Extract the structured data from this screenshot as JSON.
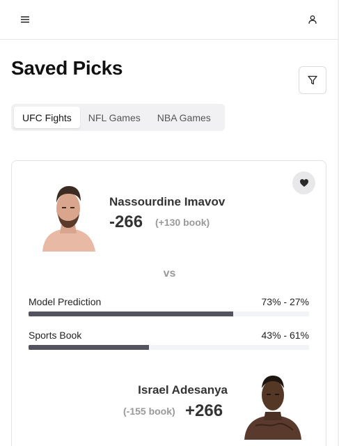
{
  "page": {
    "title": "Saved Picks"
  },
  "tabs": [
    {
      "label": "UFC Fights",
      "active": true
    },
    {
      "label": "NFL Games",
      "active": false
    },
    {
      "label": "NBA Games",
      "active": false
    }
  ],
  "icons": {
    "menu": "menu-icon",
    "user": "user-icon",
    "filter": "filter-icon",
    "favorite": "heart-icon"
  },
  "card": {
    "fighter1": {
      "name": "Nassourdine Imavov",
      "odds": "-266",
      "book": "(+130 book)"
    },
    "vs": "vs",
    "model_prediction": {
      "label": "Model Prediction",
      "value": "73% - 27%",
      "fill": 0.73
    },
    "sports_book": {
      "label": "Sports Book",
      "value": "43% - 61%",
      "fill": 0.43
    },
    "fighter2": {
      "name": "Israel Adesanya",
      "odds": "+266",
      "book": "(-155 book)"
    }
  },
  "colors": {
    "bar_fill": "#53535f",
    "bar_track": "#f2f3f7",
    "tab_bg": "#f1f1f3"
  }
}
